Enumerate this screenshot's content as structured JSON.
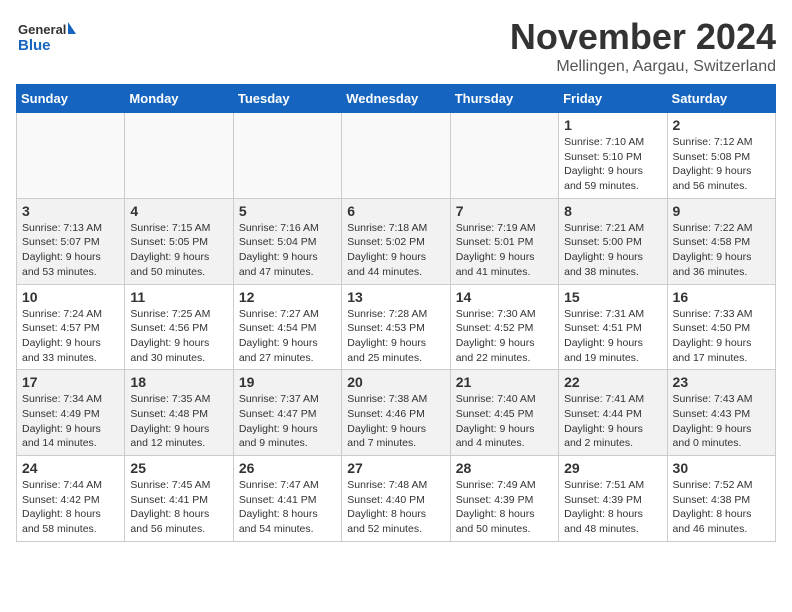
{
  "logo": {
    "general": "General",
    "blue": "Blue"
  },
  "header": {
    "month": "November 2024",
    "location": "Mellingen, Aargau, Switzerland"
  },
  "weekdays": [
    "Sunday",
    "Monday",
    "Tuesday",
    "Wednesday",
    "Thursday",
    "Friday",
    "Saturday"
  ],
  "weeks": [
    [
      {
        "day": "",
        "info": ""
      },
      {
        "day": "",
        "info": ""
      },
      {
        "day": "",
        "info": ""
      },
      {
        "day": "",
        "info": ""
      },
      {
        "day": "",
        "info": ""
      },
      {
        "day": "1",
        "info": "Sunrise: 7:10 AM\nSunset: 5:10 PM\nDaylight: 9 hours and 59 minutes."
      },
      {
        "day": "2",
        "info": "Sunrise: 7:12 AM\nSunset: 5:08 PM\nDaylight: 9 hours and 56 minutes."
      }
    ],
    [
      {
        "day": "3",
        "info": "Sunrise: 7:13 AM\nSunset: 5:07 PM\nDaylight: 9 hours and 53 minutes."
      },
      {
        "day": "4",
        "info": "Sunrise: 7:15 AM\nSunset: 5:05 PM\nDaylight: 9 hours and 50 minutes."
      },
      {
        "day": "5",
        "info": "Sunrise: 7:16 AM\nSunset: 5:04 PM\nDaylight: 9 hours and 47 minutes."
      },
      {
        "day": "6",
        "info": "Sunrise: 7:18 AM\nSunset: 5:02 PM\nDaylight: 9 hours and 44 minutes."
      },
      {
        "day": "7",
        "info": "Sunrise: 7:19 AM\nSunset: 5:01 PM\nDaylight: 9 hours and 41 minutes."
      },
      {
        "day": "8",
        "info": "Sunrise: 7:21 AM\nSunset: 5:00 PM\nDaylight: 9 hours and 38 minutes."
      },
      {
        "day": "9",
        "info": "Sunrise: 7:22 AM\nSunset: 4:58 PM\nDaylight: 9 hours and 36 minutes."
      }
    ],
    [
      {
        "day": "10",
        "info": "Sunrise: 7:24 AM\nSunset: 4:57 PM\nDaylight: 9 hours and 33 minutes."
      },
      {
        "day": "11",
        "info": "Sunrise: 7:25 AM\nSunset: 4:56 PM\nDaylight: 9 hours and 30 minutes."
      },
      {
        "day": "12",
        "info": "Sunrise: 7:27 AM\nSunset: 4:54 PM\nDaylight: 9 hours and 27 minutes."
      },
      {
        "day": "13",
        "info": "Sunrise: 7:28 AM\nSunset: 4:53 PM\nDaylight: 9 hours and 25 minutes."
      },
      {
        "day": "14",
        "info": "Sunrise: 7:30 AM\nSunset: 4:52 PM\nDaylight: 9 hours and 22 minutes."
      },
      {
        "day": "15",
        "info": "Sunrise: 7:31 AM\nSunset: 4:51 PM\nDaylight: 9 hours and 19 minutes."
      },
      {
        "day": "16",
        "info": "Sunrise: 7:33 AM\nSunset: 4:50 PM\nDaylight: 9 hours and 17 minutes."
      }
    ],
    [
      {
        "day": "17",
        "info": "Sunrise: 7:34 AM\nSunset: 4:49 PM\nDaylight: 9 hours and 14 minutes."
      },
      {
        "day": "18",
        "info": "Sunrise: 7:35 AM\nSunset: 4:48 PM\nDaylight: 9 hours and 12 minutes."
      },
      {
        "day": "19",
        "info": "Sunrise: 7:37 AM\nSunset: 4:47 PM\nDaylight: 9 hours and 9 minutes."
      },
      {
        "day": "20",
        "info": "Sunrise: 7:38 AM\nSunset: 4:46 PM\nDaylight: 9 hours and 7 minutes."
      },
      {
        "day": "21",
        "info": "Sunrise: 7:40 AM\nSunset: 4:45 PM\nDaylight: 9 hours and 4 minutes."
      },
      {
        "day": "22",
        "info": "Sunrise: 7:41 AM\nSunset: 4:44 PM\nDaylight: 9 hours and 2 minutes."
      },
      {
        "day": "23",
        "info": "Sunrise: 7:43 AM\nSunset: 4:43 PM\nDaylight: 9 hours and 0 minutes."
      }
    ],
    [
      {
        "day": "24",
        "info": "Sunrise: 7:44 AM\nSunset: 4:42 PM\nDaylight: 8 hours and 58 minutes."
      },
      {
        "day": "25",
        "info": "Sunrise: 7:45 AM\nSunset: 4:41 PM\nDaylight: 8 hours and 56 minutes."
      },
      {
        "day": "26",
        "info": "Sunrise: 7:47 AM\nSunset: 4:41 PM\nDaylight: 8 hours and 54 minutes."
      },
      {
        "day": "27",
        "info": "Sunrise: 7:48 AM\nSunset: 4:40 PM\nDaylight: 8 hours and 52 minutes."
      },
      {
        "day": "28",
        "info": "Sunrise: 7:49 AM\nSunset: 4:39 PM\nDaylight: 8 hours and 50 minutes."
      },
      {
        "day": "29",
        "info": "Sunrise: 7:51 AM\nSunset: 4:39 PM\nDaylight: 8 hours and 48 minutes."
      },
      {
        "day": "30",
        "info": "Sunrise: 7:52 AM\nSunset: 4:38 PM\nDaylight: 8 hours and 46 minutes."
      }
    ]
  ]
}
